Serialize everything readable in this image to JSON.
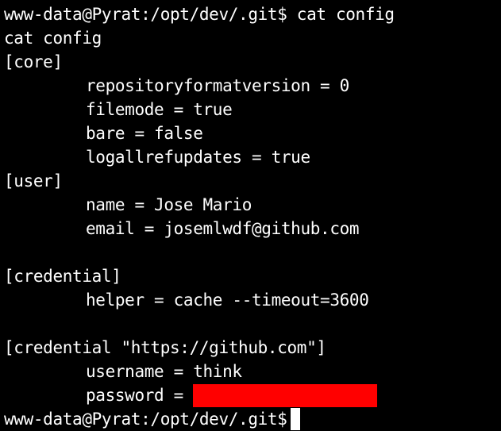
{
  "terminal": {
    "prompt_user_host": "www-data@Pyrat:/opt/dev/.git$",
    "command": "cat config",
    "echo": "cat config",
    "sections": {
      "core_header": "[core]",
      "core_repositoryformatversion": "repositoryformatversion = 0",
      "core_filemode": "filemode = true",
      "core_bare": "bare = false",
      "core_logallrefupdates": "logallrefupdates = true",
      "user_header": "[user]",
      "user_name": "name = Jose Mario",
      "user_email": "email = josemlwdf@github.com",
      "credential_header": "[credential]",
      "credential_helper": "helper = cache --timeout=3600",
      "credential_github_header": "[credential \"https://github.com\"]",
      "credential_username": "username = think",
      "credential_password_label": "password = "
    },
    "final_prompt": "www-data@Pyrat:/opt/dev/.git$",
    "colors": {
      "background": "#000000",
      "foreground": "#ffffff",
      "redaction": "#ff0000",
      "cursor": "#ffffff"
    }
  }
}
